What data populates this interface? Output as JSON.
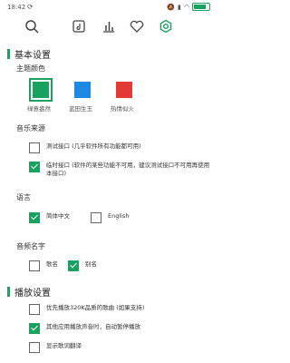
{
  "status_bar": {
    "time": "18:42",
    "sync_icon": "sync-icon",
    "battery_color": "#19a15f"
  },
  "toolbar": {
    "icons": [
      "search-icon",
      "document-icon",
      "chart-icon",
      "heart-icon",
      "settings-icon"
    ],
    "active_color": "#19a15f"
  },
  "basic": {
    "title": "基本设置",
    "theme_label": "主题颜色",
    "themes": [
      {
        "name": "绿意盎然",
        "color": "#19a15f",
        "selected": true
      },
      {
        "name": "蓝田生玉",
        "color": "#1e88e5",
        "selected": false
      },
      {
        "name": "热情似火",
        "color": "#e53935",
        "selected": false
      }
    ],
    "source_label": "音乐来源",
    "sources": [
      {
        "text": "测试接口 (几乎软件所有功能都可用)",
        "checked": false
      },
      {
        "text": "临时接口 (软件的某些功能不可用，建议测试接口不可用再使用本接口)",
        "checked": true
      }
    ],
    "language_label": "语言",
    "languages": [
      {
        "text": "简体中文",
        "checked": true
      },
      {
        "text": "English",
        "checked": false
      }
    ],
    "name_label": "音频名字",
    "names": [
      {
        "text": "歌名",
        "checked": false
      },
      {
        "text": "别名",
        "checked": true
      }
    ]
  },
  "playback": {
    "title": "播放设置",
    "options": [
      {
        "text": "优先播放320K品质的歌曲 (如果支持)",
        "checked": false
      },
      {
        "text": "其他应用播放声音时，自动暂停播放",
        "checked": true
      },
      {
        "text": "显示歌词翻译",
        "checked": false
      }
    ]
  }
}
